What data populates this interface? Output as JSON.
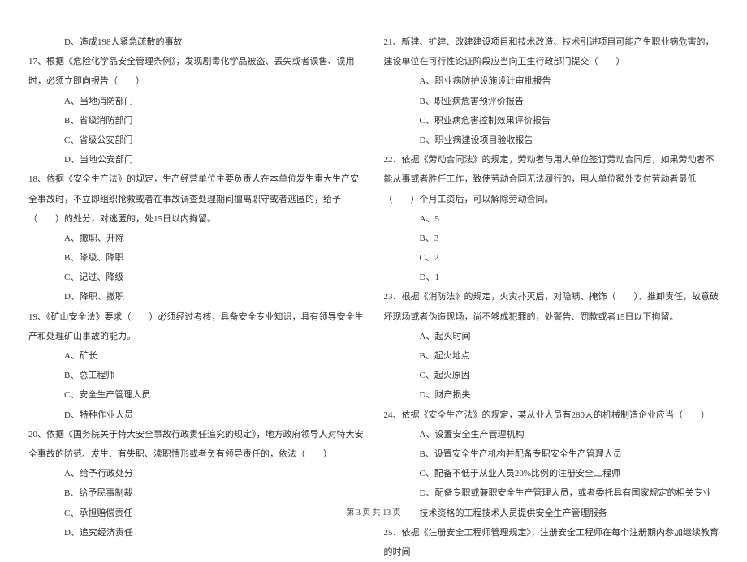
{
  "left": {
    "l0": "D、造成198人紧急疏散的事故",
    "q17": "17、根据《危险化学品安全管理条例》，发现剧毒化学品被盗、丢失或者误售、误用时，必须立即向报告（　　）",
    "q17a": "A、当地消防部门",
    "q17b": "B、省级消防部门",
    "q17c": "C、省级公安部门",
    "q17d": "D、当地公安部门",
    "q18": "18、依据《安全生产法》的规定，生产经营单位主要负责人在本单位发生重大生产安全事故时，不立即组织抢救或者在事故调查处理期间擅离职守或者逃匿的，给予（　　）的处分，对逃匿的，处15日以内拘留。",
    "q18a": "A、撤职、开除",
    "q18b": "B、降级、降职",
    "q18c": "C、记过、降级",
    "q18d": "D、降职、撤职",
    "q19": "19、《矿山安全法》要求（　　）必须经过考核，具备安全专业知识，具有领导安全生产和处理矿山事故的能力。",
    "q19a": "A、矿长",
    "q19b": "B、总工程师",
    "q19c": "C、安全生产管理人员",
    "q19d": "D、特种作业人员",
    "q20": "20、依据《国务院关于特大安全事故行政责任追究的规定》，地方政府领导人对特大安全事故的防范、发生、有失职、渎职情形或者负有领导责任的，依法（　　）",
    "q20a": "A、给予行政处分",
    "q20b": "B、给予民事制裁",
    "q20c": "C、承担赔偿责任",
    "q20d": "D、追究经济责任"
  },
  "right": {
    "q21": "21、新建、扩建、改建建设项目和技术改造、技术引进项目可能产生职业病危害的，建设单位在可行性论证阶段应当向卫生行政部门提交（　　）",
    "q21a": "A、职业病防护设施设计审批报告",
    "q21b": "B、职业病危害预评价报告",
    "q21c": "C、职业病危害控制效果评价报告",
    "q21d": "D、职业病建设项目验收报告",
    "q22": "22、依据《劳动合同法》的规定，劳动者与用人单位签订劳动合同后，如果劳动者不能从事或者胜任工作，致使劳动合同无法履行的，用人单位额外支付劳动者最低（　　）个月工资后，可以解除劳动合同。",
    "q22a": "A、5",
    "q22b": "B、3",
    "q22c": "C、2",
    "q22d": "D、1",
    "q23": "23、根据《消防法》的规定，火灾扑灭后，对隐瞒、掩饰（　　）、推卸责任，故意破坏现场或者伪造现场，尚不够成犯罪的，处警告、罚款或者15日以下拘留。",
    "q23a": "A、起火时间",
    "q23b": "B、起火地点",
    "q23c": "C、起火原因",
    "q23d": "D、财产损失",
    "q24": "24、依据《安全生产法》的规定，某从业人员有280人的机械制造企业应当（　　）",
    "q24a": "A、设置安全生产管理机构",
    "q24b": "B、设置安全生产机构并配备专职安全生产管理人员",
    "q24c": "C、配备不低于从业人员20%比例的注册安全工程师",
    "q24d": "D、配备专职或兼职安全生产管理人员，或者委托具有国家规定的相关专业技术资格的工程技术人员提供安全生产管理服务",
    "q25": "25、依据《注册安全工程师管理规定》，注册安全工程师在每个注册期内参加继续教育的时间"
  },
  "footer": "第 3 页 共 13 页"
}
